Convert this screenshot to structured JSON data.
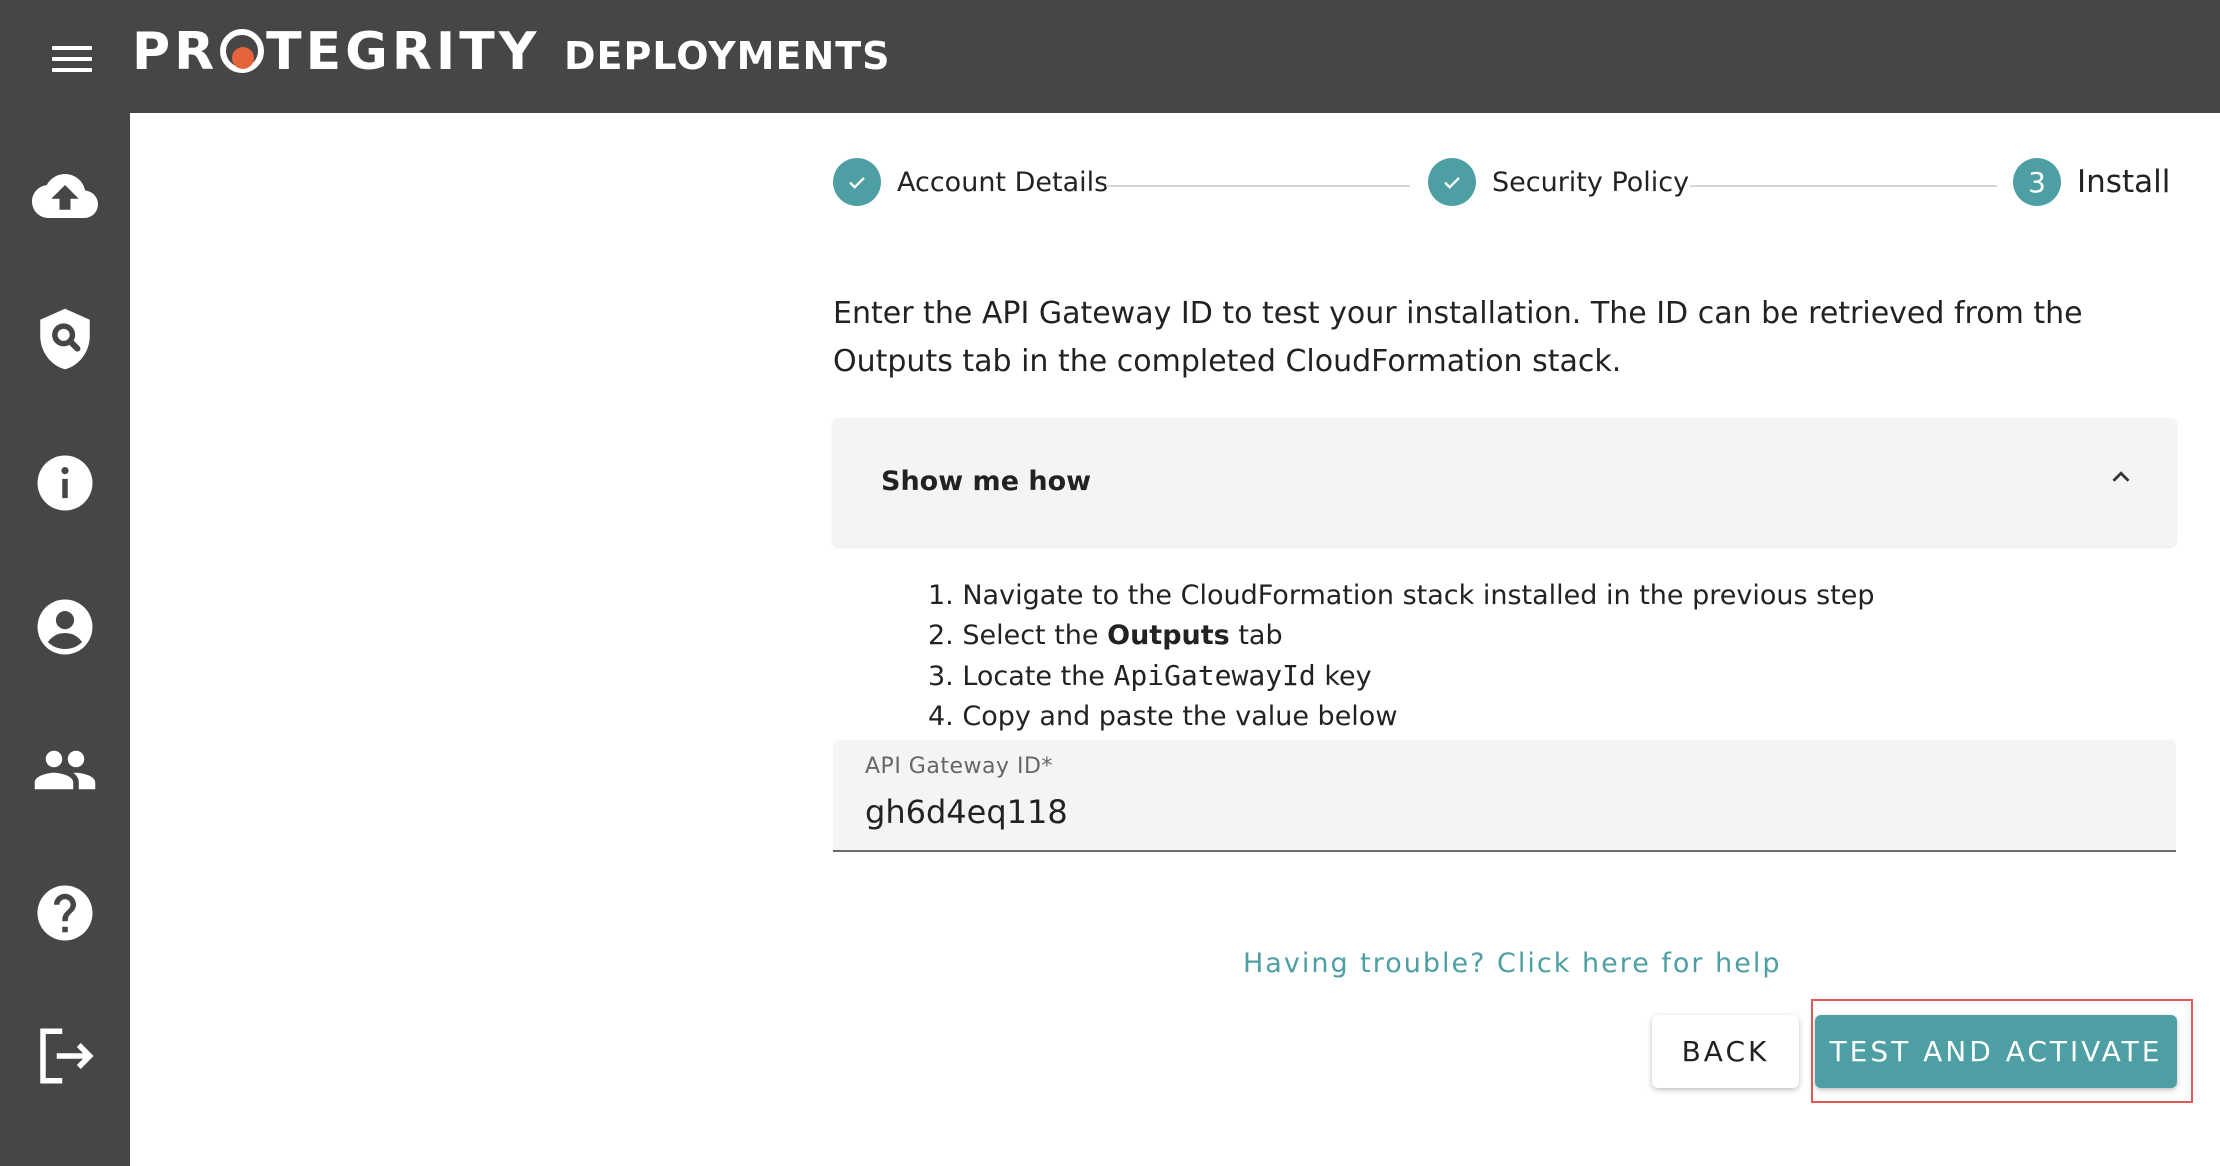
{
  "header": {
    "logo_text_pre": "PR",
    "logo_text_post": "TEGRITY",
    "app_title": "DEPLOYMENTS"
  },
  "sidebar": {
    "items": [
      {
        "icon": "cloud-upload-icon"
      },
      {
        "icon": "shield-search-icon"
      },
      {
        "icon": "info-icon"
      },
      {
        "icon": "account-icon"
      },
      {
        "icon": "people-icon"
      },
      {
        "icon": "help-icon"
      },
      {
        "icon": "logout-icon"
      }
    ]
  },
  "stepper": {
    "steps": [
      {
        "label": "Account Details",
        "status": "complete"
      },
      {
        "label": "Security Policy",
        "status": "complete"
      },
      {
        "label": "Install",
        "number": "3",
        "status": "active"
      }
    ]
  },
  "instruction": {
    "text": "Enter the API Gateway ID to test your installation. The ID can be retrieved from the Outputs tab in the completed CloudFormation stack."
  },
  "accordion": {
    "title": "Show me how",
    "steps": {
      "s1": "1. Navigate to the CloudFormation stack installed in the previous step",
      "s2_pre": "2. Select the ",
      "s2_bold": "Outputs",
      "s2_post": " tab",
      "s3_pre": "3. Locate the ",
      "s3_code": "ApiGatewayId",
      "s3_post": " key",
      "s4": "4. Copy and paste the value below"
    }
  },
  "field": {
    "label": "API Gateway ID*",
    "value": "gh6d4eq118"
  },
  "help_link": "Having trouble? Click here for help",
  "buttons": {
    "back": "BACK",
    "test": "TEST AND ACTIVATE"
  },
  "colors": {
    "accent": "#4d9fa4",
    "topbar": "#464646",
    "highlight": "#e45757"
  }
}
